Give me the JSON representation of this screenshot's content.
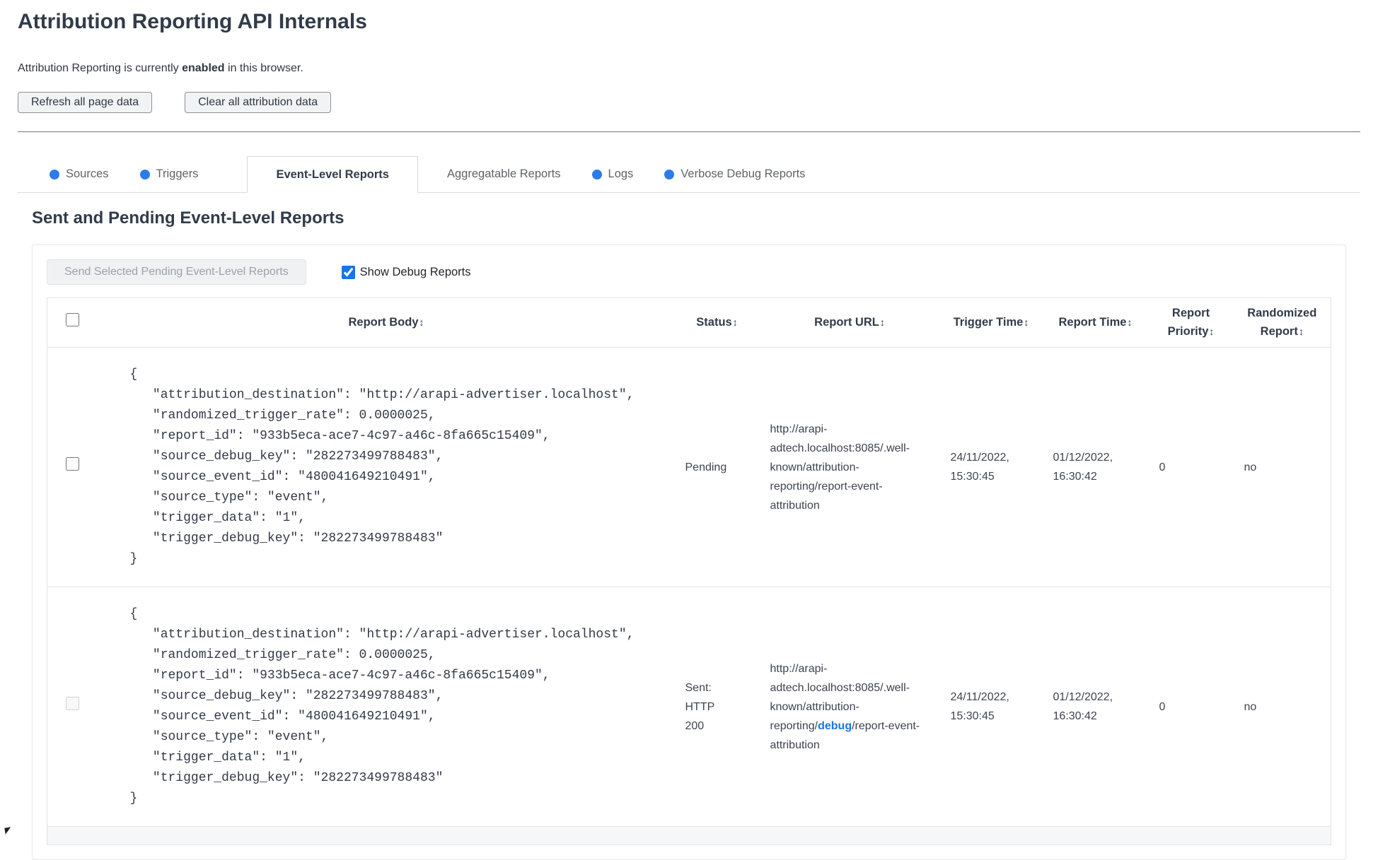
{
  "header": {
    "title": "Attribution Reporting API Internals",
    "status_prefix": "Attribution Reporting is currently ",
    "status_highlight": "enabled",
    "status_suffix": " in this browser.",
    "refresh_button": "Refresh all page data",
    "clear_button": "Clear all attribution data"
  },
  "tabs": [
    {
      "label": "Sources",
      "has_dot": true,
      "active": false
    },
    {
      "label": "Triggers",
      "has_dot": true,
      "active": false
    },
    {
      "label": "Event-Level Reports",
      "has_dot": false,
      "active": true
    },
    {
      "label": "Aggregatable Reports",
      "has_dot": false,
      "active": false
    },
    {
      "label": "Logs",
      "has_dot": true,
      "active": false
    },
    {
      "label": "Verbose Debug Reports",
      "has_dot": true,
      "active": false
    }
  ],
  "panel": {
    "heading": "Sent and Pending Event-Level Reports",
    "send_button_label": "Send Selected Pending Event-Level Reports",
    "show_debug_label": "Show Debug Reports",
    "show_debug_checked": "checked"
  },
  "table": {
    "sort_icon": "↕",
    "columns": {
      "report_body": "Report Body",
      "status": "Status",
      "report_url": "Report URL",
      "trigger_time": "Trigger Time",
      "report_time": "Report Time",
      "report_priority": "Report Priority",
      "randomized_report": "Randomized Report"
    },
    "rows": [
      {
        "report_body": "{\n   \"attribution_destination\": \"http://arapi-advertiser.localhost\",\n   \"randomized_trigger_rate\": 0.0000025,\n   \"report_id\": \"933b5eca-ace7-4c97-a46c-8fa665c15409\",\n   \"source_debug_key\": \"282273499788483\",\n   \"source_event_id\": \"480041649210491\",\n   \"source_type\": \"event\",\n   \"trigger_data\": \"1\",\n   \"trigger_debug_key\": \"282273499788483\"\n}",
        "status": "Pending",
        "url_prefix": "http://arapi-adtech.localhost:8085/.well-known/attribution-reporting/report-event-attribution",
        "url_debug": "",
        "url_suffix": "",
        "trigger_time": "24/11/2022, 15:30:45",
        "report_time": "01/12/2022, 16:30:42",
        "report_priority": "0",
        "randomized_report": "no"
      },
      {
        "report_body": "{\n   \"attribution_destination\": \"http://arapi-advertiser.localhost\",\n   \"randomized_trigger_rate\": 0.0000025,\n   \"report_id\": \"933b5eca-ace7-4c97-a46c-8fa665c15409\",\n   \"source_debug_key\": \"282273499788483\",\n   \"source_event_id\": \"480041649210491\",\n   \"source_type\": \"event\",\n   \"trigger_data\": \"1\",\n   \"trigger_debug_key\": \"282273499788483\"\n}",
        "status": "Sent:\nHTTP\n200",
        "url_prefix": "http://arapi-adtech.localhost:8085/.well-known/attribution-reporting/",
        "url_debug": "debug",
        "url_suffix": "/report-event-attribution",
        "trigger_time": "24/11/2022, 15:30:45",
        "report_time": "01/12/2022, 16:30:42",
        "report_priority": "0",
        "randomized_report": "no"
      }
    ]
  },
  "colors": {
    "accent_blue": "#1a73e8",
    "tab_dot_blue": "#2b7ce9",
    "heading_text": "#323b49"
  }
}
